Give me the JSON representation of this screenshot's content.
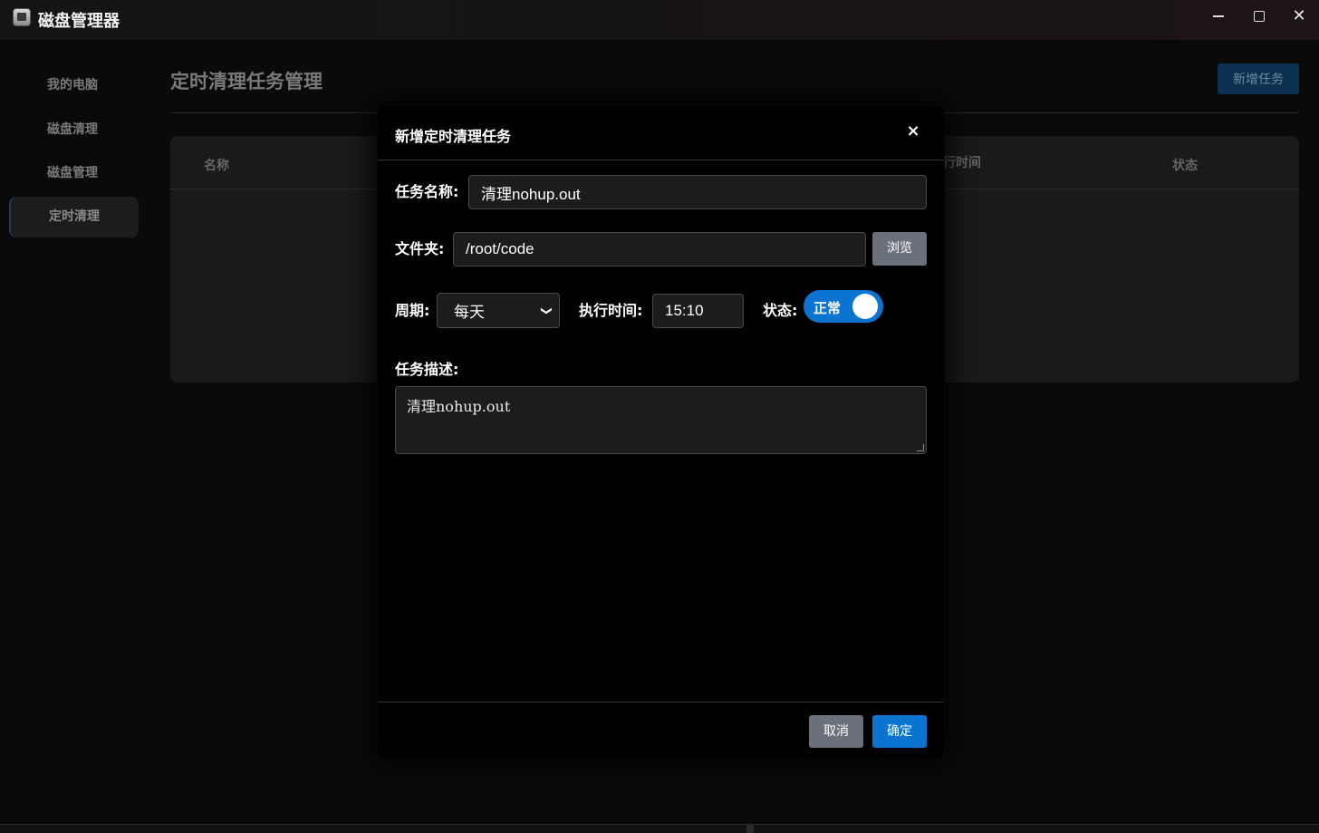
{
  "window": {
    "title": "磁盘管理器",
    "icons": {
      "app": "drive-icon",
      "minimize": "minimize-icon",
      "maximize": "maximize-icon",
      "close": "close-icon"
    }
  },
  "sidebar": {
    "items": [
      {
        "label": "我的电脑",
        "active": false
      },
      {
        "label": "磁盘清理",
        "active": false
      },
      {
        "label": "磁盘管理",
        "active": false
      },
      {
        "label": "定时清理",
        "active": true
      }
    ]
  },
  "main": {
    "title": "定时清理任务管理",
    "add_button": "新增任务",
    "table": {
      "columns": [
        "名称",
        "行时间",
        "状态"
      ]
    }
  },
  "modal": {
    "title": "新增定时清理任务",
    "close_glyph": "×",
    "name_label": "任务名称:",
    "name_value": "清理nohup.out",
    "folder_label": "文件夹:",
    "folder_value": "/root/code",
    "browse_button": "浏览",
    "period_label": "周期:",
    "period_value": "每天",
    "time_label": "执行时间:",
    "time_value": "15:10",
    "status_label": "状态:",
    "status_toggle_label": "正常",
    "status_on": true,
    "desc_label": "任务描述:",
    "desc_value": "清理nohup.out",
    "cancel_button": "取消",
    "ok_button": "确定"
  },
  "colors": {
    "accent": "#0a74d0",
    "secondary_button": "#6a717a",
    "background": "#0a0a0a"
  }
}
